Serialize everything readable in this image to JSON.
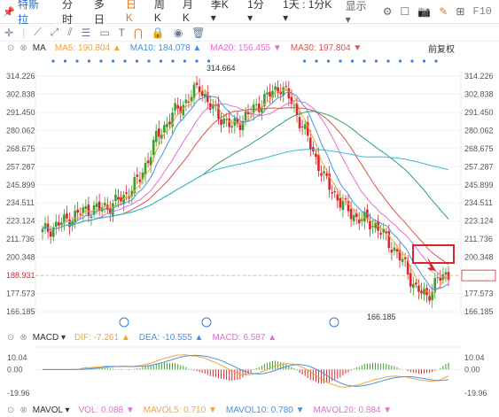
{
  "topbar": {
    "stock_name": "特斯拉",
    "tabs": [
      "分时",
      "多日",
      "日K",
      "周K",
      "月K",
      "季K ▾",
      "1分 ▾",
      "1天 : 1分K ▾"
    ],
    "active_tab": 2,
    "display_label": "显示 ▾",
    "f10": "F10"
  },
  "ma_legend": {
    "label": "MA",
    "ma5": "MA5: 190.804 ▲",
    "ma10": "MA10: 184.078 ▲",
    "ma20": "MA20: 156.455 ▼",
    "ma30": "MA30: 197.804 ▼",
    "adjust": "前复权"
  },
  "macd_legend": {
    "label": "MACD ▾",
    "dif": "DIF: -7.261 ▲",
    "dea": "DEA: -10.555 ▲",
    "macd": "MACD: 6.587 ▲"
  },
  "vol_legend": {
    "label": "MAVOL ▾",
    "vol": "VOL: 0.088 ▼",
    "mavol5": "MAVOL5: 0.710 ▼",
    "mavol10": "MAVOL10: 0.780 ▼",
    "mavol20": "MAVOL20: 0.884 ▼"
  },
  "colors": {
    "ma5": "#f2a33a",
    "ma10": "#4a90e2",
    "ma20": "#e46fd2",
    "ma30": "#d9534f",
    "ma60": "#2e9e68",
    "ma120": "#3ab8d6",
    "up": "#3b9d2c",
    "down": "#d9262c",
    "accent": "#e8731a",
    "current": "#d9262c"
  },
  "chart_data": {
    "type": "candlestick",
    "y_ticks": [
      314.226,
      302.838,
      291.45,
      280.062,
      268.675,
      257.287,
      245.899,
      234.511,
      223.124,
      211.736,
      200.348,
      188.931,
      177.573,
      166.185
    ],
    "current_price": 188.931,
    "high_label": 314.664,
    "low_label": 166.185,
    "macd_ticks": [
      10.04,
      0.0,
      -19.96
    ]
  }
}
